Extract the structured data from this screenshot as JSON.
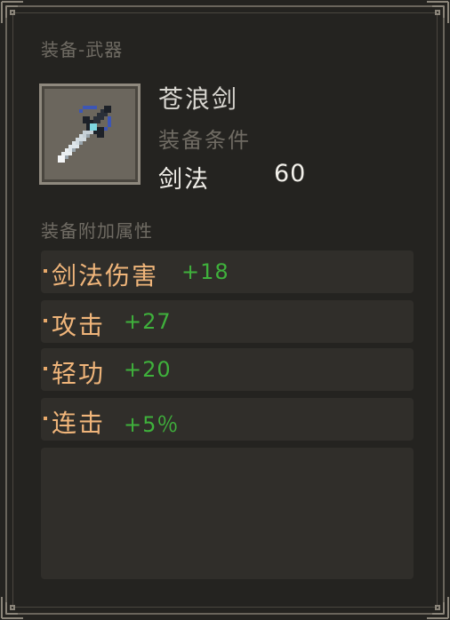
{
  "panel": {
    "section_equipment": "装备-武器",
    "section_attributes": "装备附加属性"
  },
  "item": {
    "name": "苍浪剑",
    "icon": "sword-icon",
    "requirement_label": "装备条件",
    "requirement_skill": "剑法",
    "requirement_value": "60"
  },
  "attributes": [
    {
      "name": "剑法伤害",
      "value": "+18"
    },
    {
      "name": "攻击",
      "value": "+27"
    },
    {
      "name": "轻功",
      "value": "+20"
    },
    {
      "name": "连击",
      "value": "+5％"
    }
  ],
  "colors": {
    "attribute_name": "#f0b57a",
    "attribute_value": "#3fb13c",
    "muted_label": "#6f6b63",
    "item_name": "#d8d6d0"
  }
}
